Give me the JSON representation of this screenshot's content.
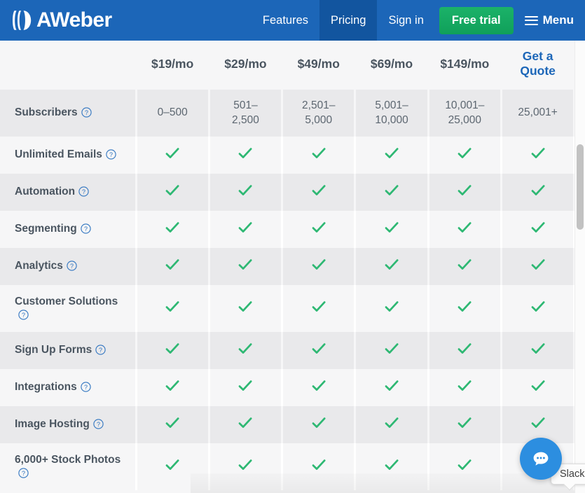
{
  "nav": {
    "brand": "AWeber",
    "brand_icon": "aweber-logo-icon",
    "items": [
      {
        "label": "Features",
        "active": false
      },
      {
        "label": "Pricing",
        "active": true
      },
      {
        "label": "Sign in",
        "active": false
      }
    ],
    "cta_label": "Free trial",
    "menu_label": "Menu",
    "menu_icon": "hamburger-icon",
    "bg_color": "#1c66b8",
    "active_bg_color": "#12559f",
    "cta_color": "#17a95f"
  },
  "table": {
    "feature_column_header": "",
    "plans": [
      {
        "price": "$19/mo",
        "is_quote": false,
        "subscribers": "0–500"
      },
      {
        "price": "$29/mo",
        "is_quote": false,
        "subscribers": "501–\n2,500"
      },
      {
        "price": "$49/mo",
        "is_quote": false,
        "subscribers": "2,501–\n5,000"
      },
      {
        "price": "$69/mo",
        "is_quote": false,
        "subscribers": "5,001–\n10,000"
      },
      {
        "price": "$149/mo",
        "is_quote": false,
        "subscribers": "10,001–\n25,000"
      },
      {
        "price": "Get a\nQuote",
        "is_quote": true,
        "subscribers": "25,001+"
      }
    ],
    "subscribers_row": {
      "label": "Subscribers",
      "help_icon": "help-circle-icon"
    },
    "features": [
      {
        "label": "Unlimited Emails",
        "help_icon": "help-circle-icon",
        "wrap": false,
        "values": [
          true,
          true,
          true,
          true,
          true,
          true
        ]
      },
      {
        "label": "Automation",
        "help_icon": "help-circle-icon",
        "wrap": false,
        "values": [
          true,
          true,
          true,
          true,
          true,
          true
        ]
      },
      {
        "label": "Segmenting",
        "help_icon": "help-circle-icon",
        "wrap": false,
        "values": [
          true,
          true,
          true,
          true,
          true,
          true
        ]
      },
      {
        "label": "Analytics",
        "help_icon": "help-circle-icon",
        "wrap": false,
        "values": [
          true,
          true,
          true,
          true,
          true,
          true
        ]
      },
      {
        "label": "Customer Solutions",
        "help_icon": "help-circle-icon",
        "wrap": true,
        "values": [
          true,
          true,
          true,
          true,
          true,
          true
        ]
      },
      {
        "label": "Sign Up Forms",
        "help_icon": "help-circle-icon",
        "wrap": false,
        "values": [
          true,
          true,
          true,
          true,
          true,
          true
        ]
      },
      {
        "label": "Integrations",
        "help_icon": "help-circle-icon",
        "wrap": false,
        "values": [
          true,
          true,
          true,
          true,
          true,
          true
        ]
      },
      {
        "label": "Image Hosting",
        "help_icon": "help-circle-icon",
        "wrap": false,
        "values": [
          true,
          true,
          true,
          true,
          true,
          true
        ]
      },
      {
        "label": "6,000+ Stock Photos",
        "help_icon": "help-circle-icon",
        "wrap": true,
        "values": [
          true,
          true,
          true,
          true,
          true,
          true
        ]
      }
    ],
    "check_color": "#2eb873",
    "row_alt_color": "#e9e9eb",
    "row_base_color": "#f6f6f7",
    "link_color": "#1c66b8"
  },
  "chat": {
    "icon": "chat-bubble-icon",
    "color": "#2c8ee0",
    "tooltip_label": "Slack"
  },
  "scrollbar": {
    "name": "vertical-scrollbar",
    "thumb_name": "scrollbar-thumb"
  }
}
